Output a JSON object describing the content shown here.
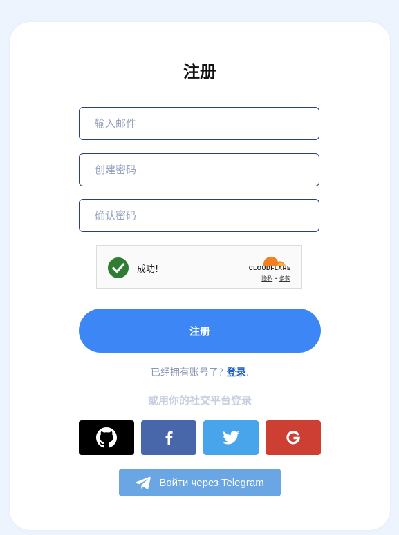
{
  "form": {
    "title": "注册",
    "email_placeholder": "输入邮件",
    "password_placeholder": "创建密码",
    "confirm_placeholder": "确认密码",
    "submit_label": "注册"
  },
  "captcha": {
    "status": "成功!",
    "brand": "CLOUDFLARE",
    "privacy": "隐私",
    "separator": "•",
    "terms": "条款"
  },
  "login": {
    "prompt": "已经拥有账号了?",
    "link": "登录",
    "suffix": "."
  },
  "social": {
    "caption": "或用你的社交平台登录",
    "buttons": [
      {
        "name": "github",
        "icon": "github-icon",
        "color": "#000000"
      },
      {
        "name": "facebook",
        "icon": "facebook-icon",
        "color": "#4767aa"
      },
      {
        "name": "twitter",
        "icon": "twitter-icon",
        "color": "#48a5ec"
      },
      {
        "name": "google",
        "icon": "google-icon",
        "color": "#cc3f32"
      }
    ],
    "telegram_label": "Войти через Telegram",
    "telegram_color": "#6aa6e4"
  },
  "colors": {
    "accent": "#3d86f6",
    "success": "#2f7d32",
    "cloudflare_orange": "#f38020"
  }
}
